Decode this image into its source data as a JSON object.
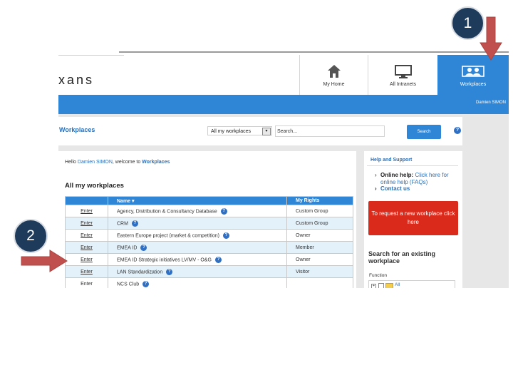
{
  "brand": "xans",
  "nav": {
    "tabs": [
      {
        "label": "My Home",
        "icon": "home-icon"
      },
      {
        "label": "All Intranets",
        "icon": "monitor-icon"
      },
      {
        "label": "Workplaces",
        "icon": "people-icon",
        "active": true
      }
    ]
  },
  "user_bar": {
    "user": "Damien SIMON"
  },
  "toolbar": {
    "title": "Workplaces",
    "select_value": "All my workplaces",
    "search_placeholder": "Search...",
    "search_button": "Search",
    "help_icon": "?"
  },
  "main": {
    "hello_prefix": "Hello ",
    "hello_name": "Damien SIMON",
    "hello_mid": ", welcome to ",
    "hello_place": "Workplaces",
    "section_title": "All my workplaces",
    "table": {
      "headers": [
        "",
        "Name ▾",
        "My Rights"
      ],
      "rows": [
        {
          "action": "Enter",
          "name": "Agency, Distribution & Consultancy Database",
          "rights": "Custom Group"
        },
        {
          "action": "Enter",
          "name": "CRM",
          "rights": "Custom Group"
        },
        {
          "action": "Enter",
          "name": "Eastern Europe project (market & competition)",
          "rights": "Owner"
        },
        {
          "action": "Enter",
          "name": "EMEA ID",
          "rights": "Member"
        },
        {
          "action": "Enter",
          "name": "EMEA ID Strategic initiatives LV/MV - O&G",
          "rights": "Owner"
        },
        {
          "action": "Enter",
          "name": "LAN Standardization",
          "rights": "Visitor"
        },
        {
          "action": "Enter",
          "name": "NCS Club",
          "rights": ""
        }
      ]
    }
  },
  "sidebar": {
    "help_title": "Help and Support",
    "online_help_label": "Online help:",
    "online_help_link": "Click here for online help (FAQs)",
    "contact_us": "Contact us",
    "request_button": "To request a new workplace click here",
    "search_existing": "Search for an existing workplace",
    "function_label": "Function",
    "tree_all": "All"
  },
  "callouts": {
    "one": "1",
    "two": "2"
  },
  "colors": {
    "accent_blue": "#2f86d6",
    "request_red": "#d92a1c",
    "arrow_red": "#c0504d",
    "callout_navy": "#1f3b5c"
  }
}
